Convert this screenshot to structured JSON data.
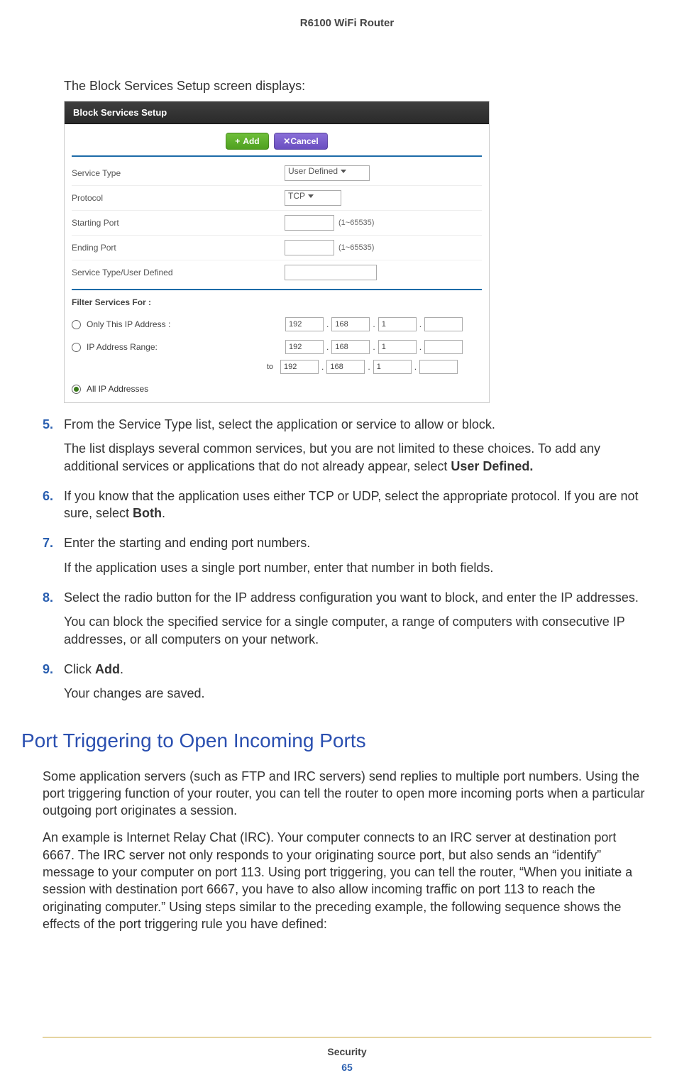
{
  "doc_header": "R6100 WiFi Router",
  "intro": "The Block Services Setup screen displays:",
  "ui": {
    "title": "Block Services Setup",
    "buttons": {
      "add": "Add",
      "cancel": "Cancel"
    },
    "labels": {
      "service_type": "Service Type",
      "protocol": "Protocol",
      "starting_port": "Starting Port",
      "ending_port": "Ending Port",
      "user_defined": "Service Type/User Defined"
    },
    "values": {
      "service_type": "User Defined",
      "protocol": "TCP",
      "port_hint": "(1~65535)"
    },
    "filter": {
      "title": "Filter Services For :",
      "only_this": "Only This IP Address :",
      "range": "IP Address Range:",
      "to": "to",
      "all": "All IP Addresses",
      "ip_a": [
        "192",
        "168",
        "1",
        ""
      ],
      "ip_b1": [
        "192",
        "168",
        "1",
        ""
      ],
      "ip_b2": [
        "192",
        "168",
        "1",
        ""
      ]
    }
  },
  "steps": {
    "s5": {
      "num": "5.",
      "line1": "From the Service Type list, select the application or service to allow or block.",
      "line2a": "The list displays several common services, but you are not limited to these choices. To add any additional services or applications that do not already appear, select ",
      "line2b": "User Defined."
    },
    "s6": {
      "num": "6.",
      "line1a": "If you know that the application uses either TCP or UDP, select the appropriate protocol. If you are not sure, select ",
      "line1b": "Both",
      "line1c": "."
    },
    "s7": {
      "num": "7.",
      "line1": "Enter the starting and ending port numbers.",
      "line2": "If the application uses a single port number, enter that number in both fields."
    },
    "s8": {
      "num": "8.",
      "line1": "Select the radio button for the IP address configuration you want to block, and enter the IP addresses.",
      "line2": "You can block the specified service for a single computer, a range of computers with consecutive IP addresses, or all computers on your network."
    },
    "s9": {
      "num": "9.",
      "line1a": "Click ",
      "line1b": "Add",
      "line1c": ".",
      "line2": "Your changes are saved."
    }
  },
  "section_heading": "Port Triggering to Open Incoming Ports",
  "para1": "Some application servers (such as FTP and IRC servers) send replies to multiple port numbers. Using the port triggering function of your router, you can tell the router to open more incoming ports when a particular outgoing port originates a session.",
  "para2": "An example is Internet Relay Chat (IRC). Your computer connects to an IRC server at destination port 6667. The IRC server not only responds to your originating source port, but also sends an “identify” message to your computer on port 113. Using port triggering, you can tell the router, “When you initiate a session with destination port 6667, you have to also allow incoming traffic on port 113 to reach the originating computer.” Using steps similar to the preceding example, the following sequence shows the effects of the port triggering rule you have defined:",
  "footer": {
    "title": "Security",
    "page": "65"
  }
}
